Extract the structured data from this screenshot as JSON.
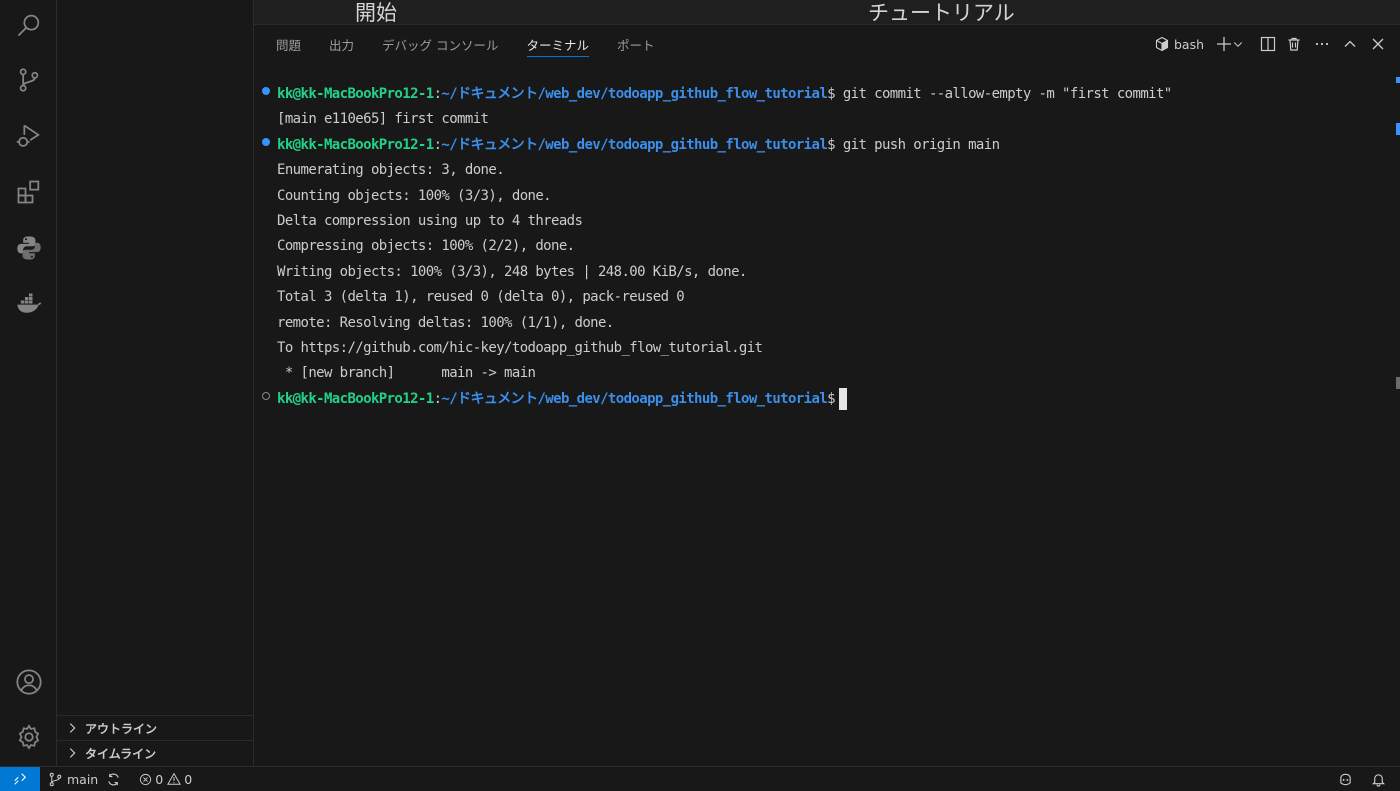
{
  "editor": {
    "heading_left": "開始",
    "heading_right": "チュートリアル"
  },
  "activity_bar": {
    "items": [
      "search",
      "source-control",
      "run-and-debug",
      "extensions",
      "python",
      "docker"
    ],
    "bottom": [
      "accounts",
      "manage"
    ]
  },
  "sidebar": {
    "sections": [
      {
        "label": "アウトライン"
      },
      {
        "label": "タイムライン"
      }
    ]
  },
  "panel": {
    "tabs": [
      {
        "label": "問題",
        "active": false
      },
      {
        "label": "出力",
        "active": false
      },
      {
        "label": "デバッグ コンソール",
        "active": false
      },
      {
        "label": "ターミナル",
        "active": true
      },
      {
        "label": "ポート",
        "active": false
      }
    ],
    "terminal_name": "bash"
  },
  "terminal": {
    "prompt_user": "kk@kk-MacBookPro12-1",
    "prompt_path": "~/ドキュメント/web_dev/todoapp_github_flow_tutorial",
    "lines": [
      {
        "type": "prompt",
        "command": " git commit --allow-empty -m \"first commit\""
      },
      {
        "type": "out",
        "text": "[main e110e65] first commit"
      },
      {
        "type": "prompt",
        "command": " git push origin main"
      },
      {
        "type": "out",
        "text": "Enumerating objects: 3, done."
      },
      {
        "type": "out",
        "text": "Counting objects: 100% (3/3), done."
      },
      {
        "type": "out",
        "text": "Delta compression using up to 4 threads"
      },
      {
        "type": "out",
        "text": "Compressing objects: 100% (2/2), done."
      },
      {
        "type": "out",
        "text": "Writing objects: 100% (3/3), 248 bytes | 248.00 KiB/s, done."
      },
      {
        "type": "out",
        "text": "Total 3 (delta 1), reused 0 (delta 0), pack-reused 0"
      },
      {
        "type": "out",
        "text": "remote: Resolving deltas: 100% (1/1), done."
      },
      {
        "type": "out",
        "text": "To https://github.com/hic-key/todoapp_github_flow_tutorial.git"
      },
      {
        "type": "out",
        "text": " * [new branch]      main -> main"
      },
      {
        "type": "prompt",
        "command": " "
      }
    ]
  },
  "status_bar": {
    "branch": "main",
    "errors": "0",
    "warnings": "0"
  },
  "colors": {
    "accent": "#0078d4",
    "prompt_user": "#23d18b",
    "prompt_path": "#3b8eea"
  }
}
